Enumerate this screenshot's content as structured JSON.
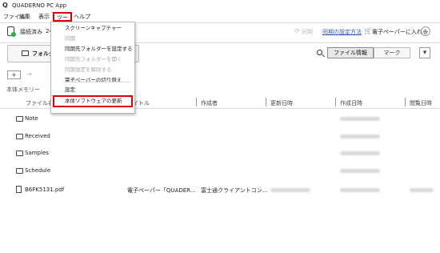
{
  "window": {
    "app_icon": "Q",
    "title": "QUADERNO PC App"
  },
  "menubar": {
    "file": "ファイル",
    "edit": "編集",
    "view": "表示",
    "tools": "ツール",
    "help": "ヘルプ"
  },
  "status": {
    "label": "接続済み",
    "count": "24",
    "dot_color": "#2bb24c"
  },
  "sync": {
    "icon": "sync-icon",
    "label": "同期",
    "settings_link": "同期の設定方法"
  },
  "buy": {
    "icon": "cart-icon",
    "label": "電子ペーパーに入れる"
  },
  "toolbar": {
    "folder_button": "フォルダー",
    "tab_fileinfo": "ファイル情報",
    "tab_mark": "マーク"
  },
  "storage_label": "本体メモリー",
  "columns": {
    "filename": "ファイル名",
    "title": "タイトル",
    "author": "作成者",
    "updated": "更新日時",
    "created": "作成日時",
    "viewed": "閲覧日時"
  },
  "rows": [
    {
      "name": "Note",
      "type": "folder"
    },
    {
      "name": "Received",
      "type": "folder"
    },
    {
      "name": "Samples",
      "type": "folder"
    },
    {
      "name": "Schedule",
      "type": "folder"
    },
    {
      "name": "B6FK5131.pdf",
      "type": "pdf",
      "title": "電子ペーパー「QUADER...",
      "author": "富士通クライアントコン..."
    }
  ],
  "tools_menu": {
    "items": [
      {
        "label": "スクリーンキャプチャー",
        "enabled": true
      },
      {
        "label": "同期",
        "enabled": false
      },
      {
        "label": "同期先フォルダーを設定する",
        "enabled": true
      },
      {
        "label": "同期先フォルダーを開く",
        "enabled": false
      },
      {
        "label": "同期設定を解除する",
        "enabled": false
      },
      {
        "label": "電子ペーパーの切り替え",
        "enabled": true
      },
      {
        "label": "設定",
        "enabled": true
      },
      {
        "label": "本体ソフトウェアの更新",
        "enabled": true,
        "highlighted": true
      }
    ]
  },
  "colors": {
    "highlight": "#d00",
    "link": "#2a5ea8"
  }
}
